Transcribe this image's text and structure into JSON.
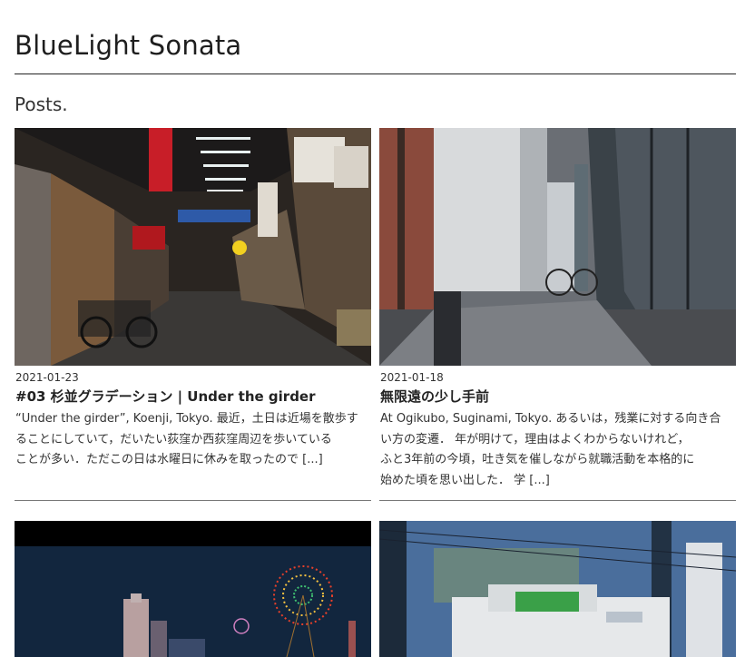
{
  "site": {
    "title": "BlueLight Sonata"
  },
  "section": {
    "title": "Posts."
  },
  "posts": [
    {
      "date": "2021-01-23",
      "title": "#03 杉並グラデーション | Under the girder",
      "excerpt_lines": [
        "“Under the girder”, Koenji, Tokyo. 最近，土日は近場を散歩す",
        "ることにしていて，だいたい荻窪か西荻窪周辺を歩いている",
        "ことが多い．ただこの日は水曜日に休みを取ったので"
      ],
      "more": "[...]",
      "photo": "photo-koenji-arcade"
    },
    {
      "date": "2021-01-18",
      "title": "無限遠の少し手前",
      "excerpt_lines": [
        "At Ogikubo, Suginami, Tokyo. あるいは，残業に対する向き合",
        "い方の変遷． 年が明けて，理由はよくわからないけれど，",
        "ふと3年前の今頃，吐き気を催しながら就職活動を本格的に",
        "始めた頃を思い出した． 学"
      ],
      "more": "[...]",
      "photo": "photo-ogikubo-alley"
    },
    {
      "photo": "photo-fireworks-night"
    },
    {
      "photo": "photo-building-through-window"
    }
  ]
}
